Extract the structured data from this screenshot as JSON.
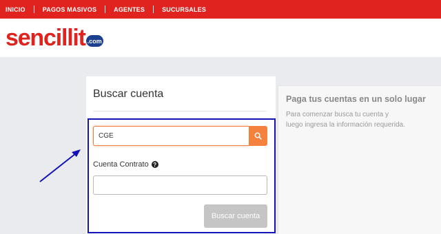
{
  "nav": {
    "items": [
      {
        "label": "INICIO"
      },
      {
        "label": "PAGOS MASIVOS"
      },
      {
        "label": "AGENTES"
      },
      {
        "label": "SUCURSALES"
      }
    ]
  },
  "header": {
    "logo_text": "sencillit",
    "logo_suffix": ".com"
  },
  "search_card": {
    "title": "Buscar cuenta",
    "company_input": {
      "value": "CGE"
    },
    "contract_label": "Cuenta Contrato",
    "contract_input": {
      "value": ""
    },
    "submit_label": "Buscar cuenta"
  },
  "info_card": {
    "title": "Paga tus cuentas en un solo lugar",
    "description": "Para comenzar busca tu cuenta y luego ingresa la información requerida."
  },
  "colors": {
    "brand_red": "#e1231f",
    "accent_orange": "#f5813f",
    "annotation_blue": "#1212b8"
  }
}
